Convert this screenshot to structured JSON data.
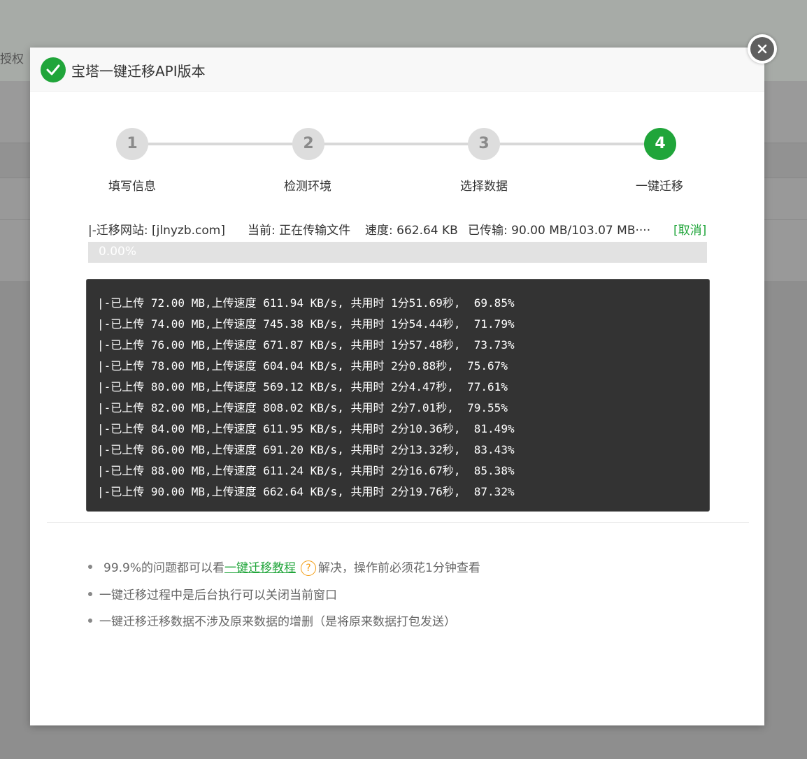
{
  "background": {
    "auth_label": "授权"
  },
  "dialog": {
    "title": "宝塔一键迁移API版本",
    "icons": {
      "title": "check-circle-icon",
      "close": "close-icon"
    },
    "colors": {
      "accent": "#20a53a",
      "log_bg": "#333333",
      "help": "#f39c12"
    }
  },
  "steps": [
    {
      "number": "1",
      "label": "填写信息",
      "active": false
    },
    {
      "number": "2",
      "label": "检测环境",
      "active": false
    },
    {
      "number": "3",
      "label": "选择数据",
      "active": false
    },
    {
      "number": "4",
      "label": "一键迁移",
      "active": true
    }
  ],
  "status": {
    "site": "|-迁移网站: [jlnyzb.com]",
    "current": "当前: 正在传输文件",
    "speed": "速度: 662.64 KB",
    "transferred": "已传输: 90.00 MB/103.07 MB····",
    "cancel": "[取消]"
  },
  "progress": {
    "value": 0.0,
    "text": "0.00%"
  },
  "log": [
    "|-已上传 72.00 MB,上传速度 611.94 KB/s, 共用时 1分51.69秒,  69.85%",
    "|-已上传 74.00 MB,上传速度 745.38 KB/s, 共用时 1分54.44秒,  71.79%",
    "|-已上传 76.00 MB,上传速度 671.87 KB/s, 共用时 1分57.48秒,  73.73%",
    "|-已上传 78.00 MB,上传速度 604.04 KB/s, 共用时 2分0.88秒,  75.67%",
    "|-已上传 80.00 MB,上传速度 569.12 KB/s, 共用时 2分4.47秒,  77.61%",
    "|-已上传 82.00 MB,上传速度 808.02 KB/s, 共用时 2分7.01秒,  79.55%",
    "|-已上传 84.00 MB,上传速度 611.95 KB/s, 共用时 2分10.36秒,  81.49%",
    "|-已上传 86.00 MB,上传速度 691.20 KB/s, 共用时 2分13.32秒,  83.43%",
    "|-已上传 88.00 MB,上传速度 611.24 KB/s, 共用时 2分16.67秒,  85.38%",
    "|-已上传 90.00 MB,上传速度 662.64 KB/s, 共用时 2分19.76秒,  87.32%"
  ],
  "notes": {
    "first_prefix": "99.9%的问题都可以看",
    "first_link": "一键迁移教程",
    "help_glyph": "?",
    "first_suffix": "解决，操作前必须花1分钟查看",
    "second": "一键迁移过程中是后台执行可以关闭当前窗口",
    "third": "一键迁移迁移数据不涉及原来数据的增删（是将原来数据打包发送）"
  }
}
